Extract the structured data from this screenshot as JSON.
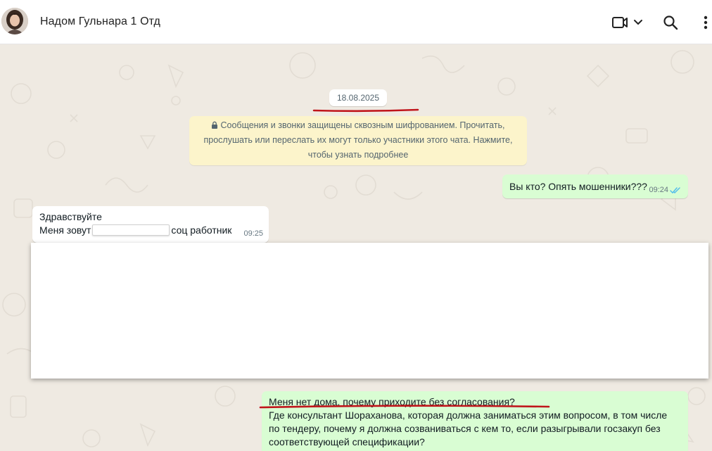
{
  "header": {
    "contact_name": "Надом Гульнара 1 Отд",
    "avatar_icon": "avatar-photo",
    "video_icon": "video-call-icon",
    "search_icon": "search-icon",
    "menu_icon": "more-vert-icon"
  },
  "chat": {
    "date_chip": "18.08.2025",
    "encryption_notice": {
      "lock_icon": "lock-icon",
      "line1": "Сообщения и звонки защищены сквозным шифрованием. Прочитать,",
      "line2": "прослушать или переслать их могут только участники этого чата. Нажмите,",
      "line3": "чтобы узнать подробнее"
    },
    "messages": [
      {
        "direction": "out",
        "text": "Вы кто? Опять мошенники???",
        "time": "09:24",
        "status": "read"
      },
      {
        "direction": "in",
        "line1": "Здравствуйте",
        "line2_prefix": "Меня зовут",
        "line2_suffix": "соц работник",
        "time": "09:25"
      },
      {
        "direction": "out",
        "line1": "Меня нет дома, почему приходите без согласования?",
        "line2": "Где консультант Шораханова, которая должна заниматься этим вопросом, в том числе",
        "line3": "по тендеру, почему я должна созваниваться с кем то, если разыгрывали госзакуп без",
        "line4": "соответствующей спецификации?"
      }
    ]
  },
  "colors": {
    "chat_background": "#efeae2",
    "outgoing_bubble": "#d9fdd3",
    "incoming_bubble": "#ffffff",
    "system_notice": "#fcf4cb",
    "read_ticks": "#53bdeb",
    "annotation_underline": "#c0151b"
  }
}
